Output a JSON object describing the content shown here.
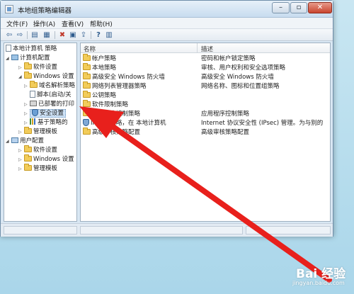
{
  "window": {
    "title": "本地组策略编辑器",
    "minimize_glyph": "–",
    "maximize_glyph": "▫",
    "close_glyph": "✕"
  },
  "menu": [
    "文件(F)",
    "操作(A)",
    "查看(V)",
    "帮助(H)"
  ],
  "toolbar": {
    "icons": [
      "back-arrow-icon",
      "forward-arrow-icon",
      "up-folder-icon",
      "show-hide-tree-icon",
      "delete-icon",
      "properties-icon",
      "export-icon",
      "help-icon",
      "filter-icon"
    ],
    "glyphs": [
      "⇦",
      "⇨",
      "▤",
      "▦",
      "✖",
      "▣",
      "⇪",
      "?",
      "▥"
    ]
  },
  "tree": [
    {
      "label": "本地计算机 策略",
      "icon": "policy-doc-icon"
    },
    {
      "label": "计算机配置",
      "icon": "computer-icon"
    },
    {
      "label": "软件设置",
      "icon": "folder-icon"
    },
    {
      "label": "Windows 设置",
      "icon": "folder-icon"
    },
    {
      "label": "域名解析策略",
      "icon": "folder-icon"
    },
    {
      "label": "脚本(启动/关",
      "icon": "script-icon"
    },
    {
      "label": "已部署的打印",
      "icon": "printer-icon"
    },
    {
      "label": "安全设置",
      "icon": "shield-icon"
    },
    {
      "label": "基于策略的",
      "icon": "chart-icon"
    },
    {
      "label": "管理模板",
      "icon": "folder-icon"
    },
    {
      "label": "用户配置",
      "icon": "user-icon"
    },
    {
      "label": "软件设置",
      "icon": "folder-icon"
    },
    {
      "label": "Windows 设置",
      "icon": "folder-icon"
    },
    {
      "label": "管理模板",
      "icon": "folder-icon"
    }
  ],
  "list": {
    "columns": [
      "名称",
      "描述"
    ],
    "rows": [
      {
        "name": "帐户策略",
        "desc": "密码和帐户锁定策略"
      },
      {
        "name": "本地策略",
        "desc": "审核、用户权利和安全选项策略"
      },
      {
        "name": "高级安全 Windows 防火墙",
        "desc": "高级安全 Windows 防火墙"
      },
      {
        "name": "网络列表管理器策略",
        "desc": "网络名称、图标和位置组策略"
      },
      {
        "name": "公钥策略",
        "desc": ""
      },
      {
        "name": "软件限制策略",
        "desc": ""
      },
      {
        "name": "应用程序控制策略",
        "desc": "应用程序控制策略"
      },
      {
        "name": "IP 安全策略，在 本地计算机",
        "desc": "Internet 协议安全性 (IPsec) 管理。为与别的"
      },
      {
        "name": "高级审核策略配置",
        "desc": "高级审核策略配置"
      }
    ]
  },
  "watermark": {
    "brand": "Bai 经验",
    "url": "jingyan.baidu.com"
  },
  "colors": {
    "arrow": "#e8201c",
    "selection": "#cfe3f7"
  }
}
